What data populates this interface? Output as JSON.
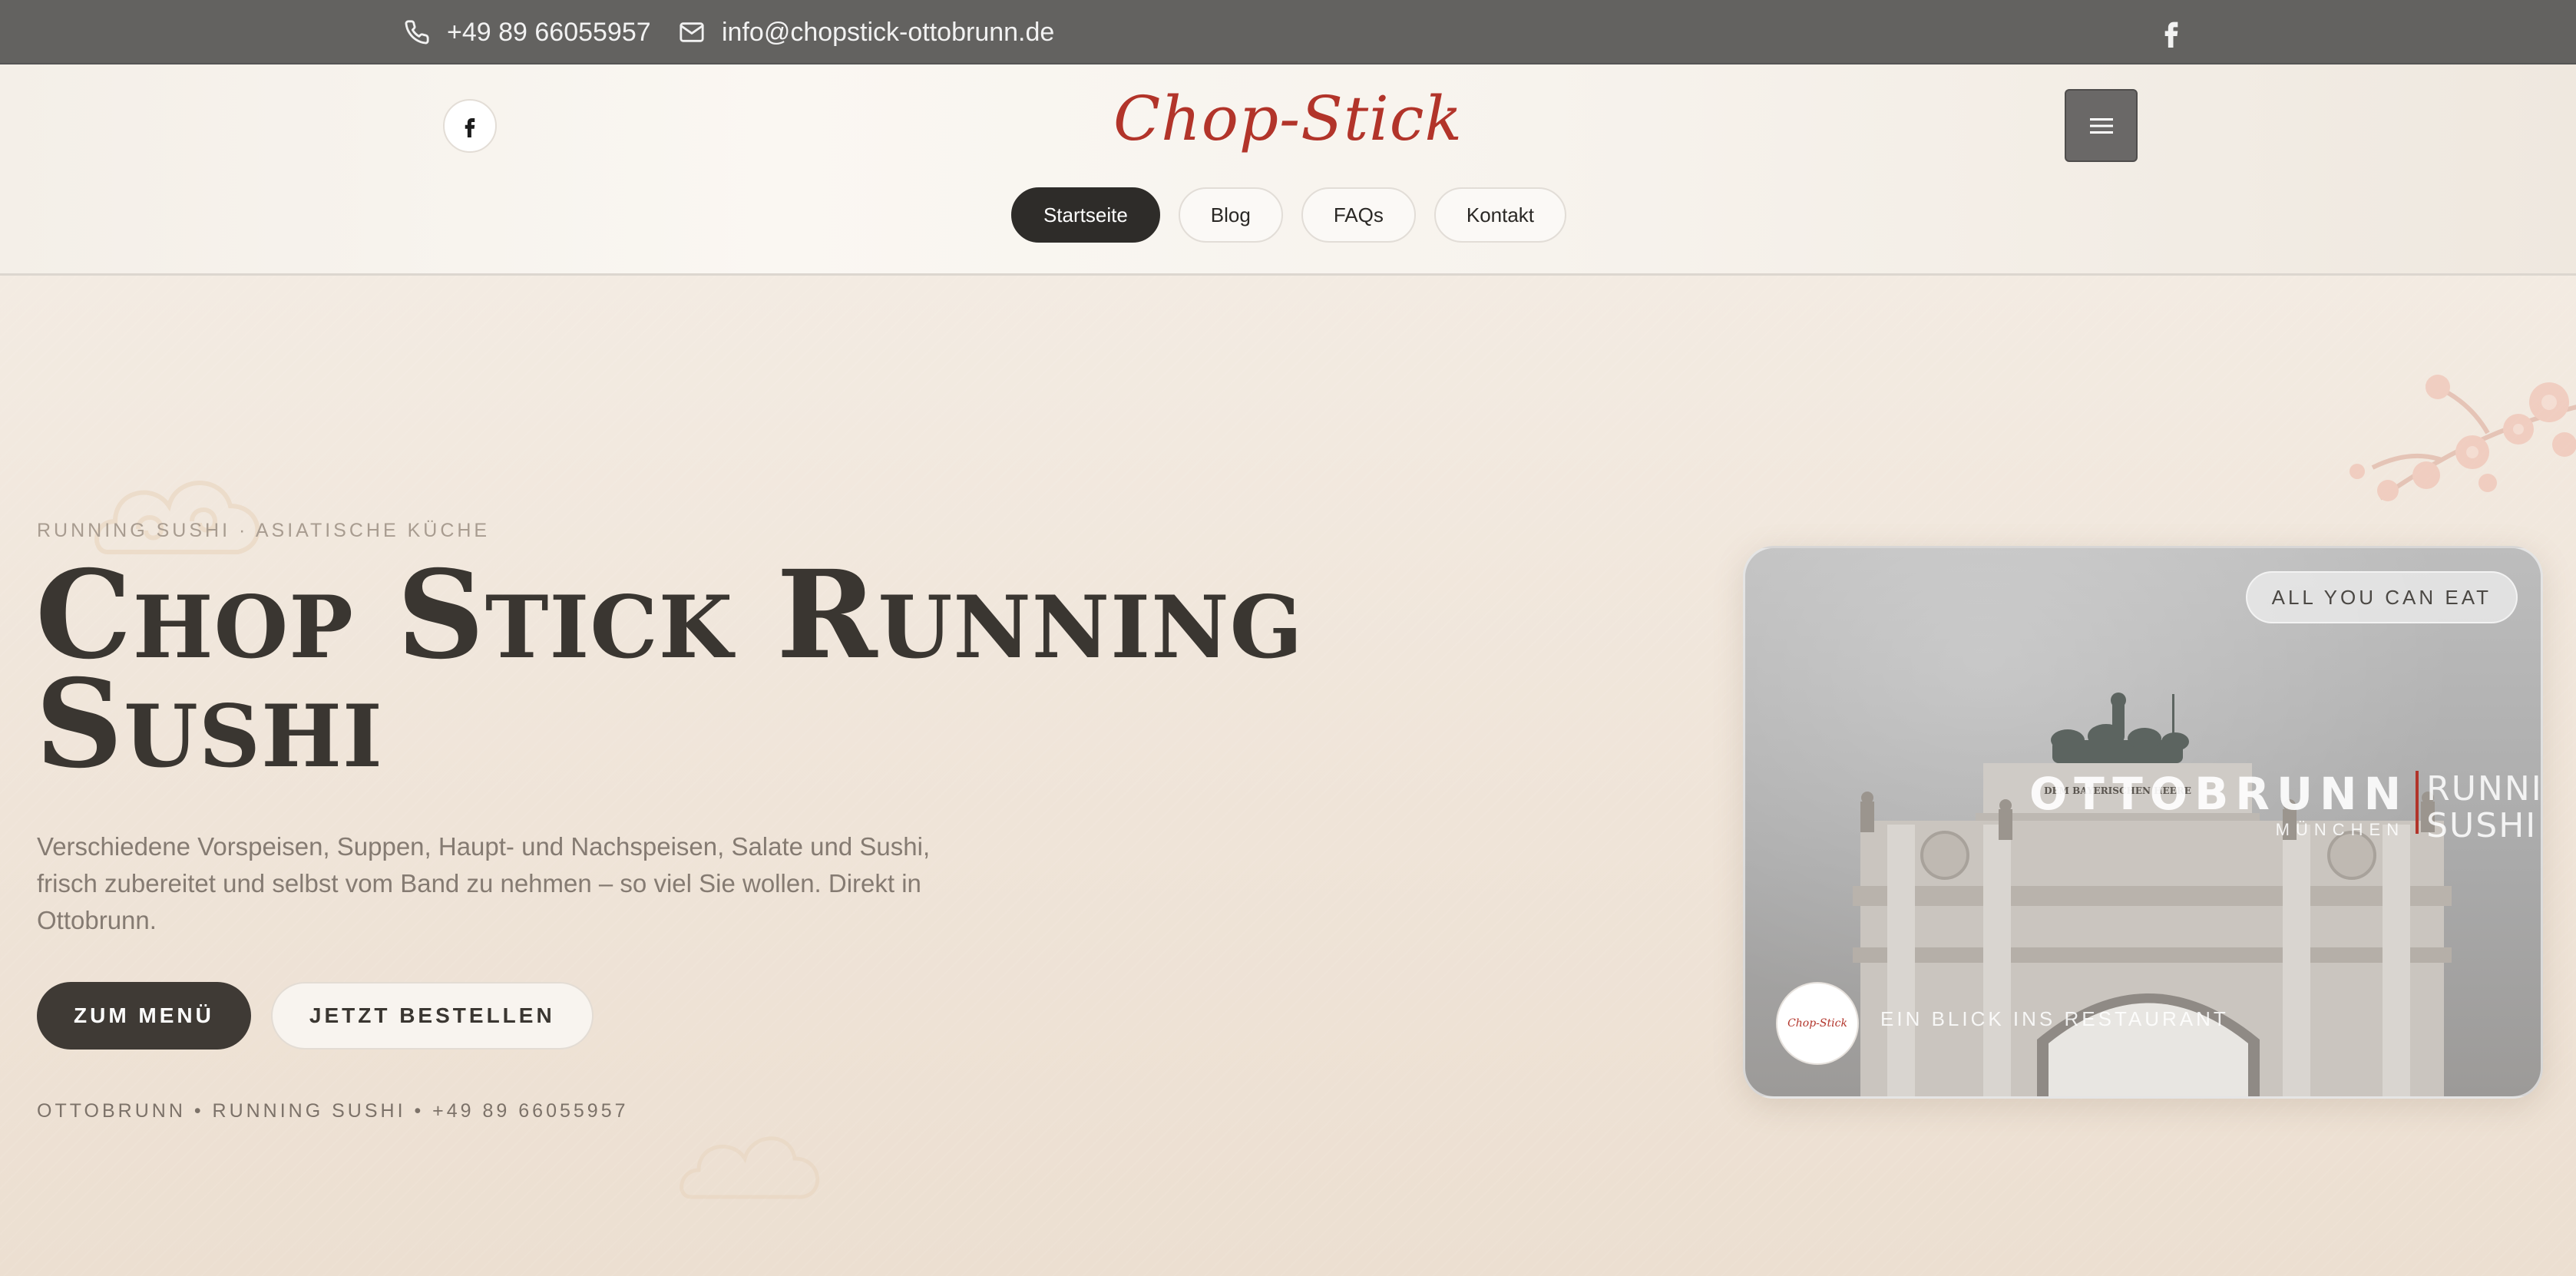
{
  "topbar": {
    "phone": "+49 89 66055957",
    "email": "info@chopstick-ottobrunn.de",
    "icons": {
      "phone": "phone-icon",
      "email": "mail-icon",
      "social": "facebook-icon"
    }
  },
  "header": {
    "logo_text": "Chop-Stick",
    "menu_icon": "hamburger-icon",
    "nav": [
      {
        "label": "Startseite",
        "active": true
      },
      {
        "label": "Blog",
        "active": false
      },
      {
        "label": "FAQs",
        "active": false
      },
      {
        "label": "Kontakt",
        "active": false
      }
    ]
  },
  "hero": {
    "eyebrow": "RUNNING SUSHI · ASIATISCHE KÜCHE",
    "title_line1": "Chop Stick Running",
    "title_line2": "Sushi",
    "description": "Verschiedene Vorspeisen, Suppen, Haupt- und Nachspeisen, Salate und Sushi, frisch zubereitet und selbst vom Band zu nehmen – so viel Sie wollen. Direkt in Ottobrunn.",
    "primary_button": "ZUM MENÜ",
    "secondary_button": "JETZT BESTELLEN",
    "meta": "OTTOBRUNN • RUNNING SUSHI • +49 89 66055957"
  },
  "media_card": {
    "badge": "ALL YOU CAN EAT",
    "overlay_city": "OTTOBRUNN",
    "overlay_region": "MÜNCHEN",
    "overlay_right_line1": "RUNNING",
    "overlay_right_line2": "SUSHI",
    "arch_inscription": "DEM BAYERISCHEN HEERE",
    "mini_logo": "Chop-Stick",
    "caption": "EIN BLICK INS RESTAURANT"
  },
  "colors": {
    "topbar": "#636260",
    "logo_red": "#b2342a",
    "dark": "#2e2c29",
    "hero_bg": "#efe4d8"
  }
}
